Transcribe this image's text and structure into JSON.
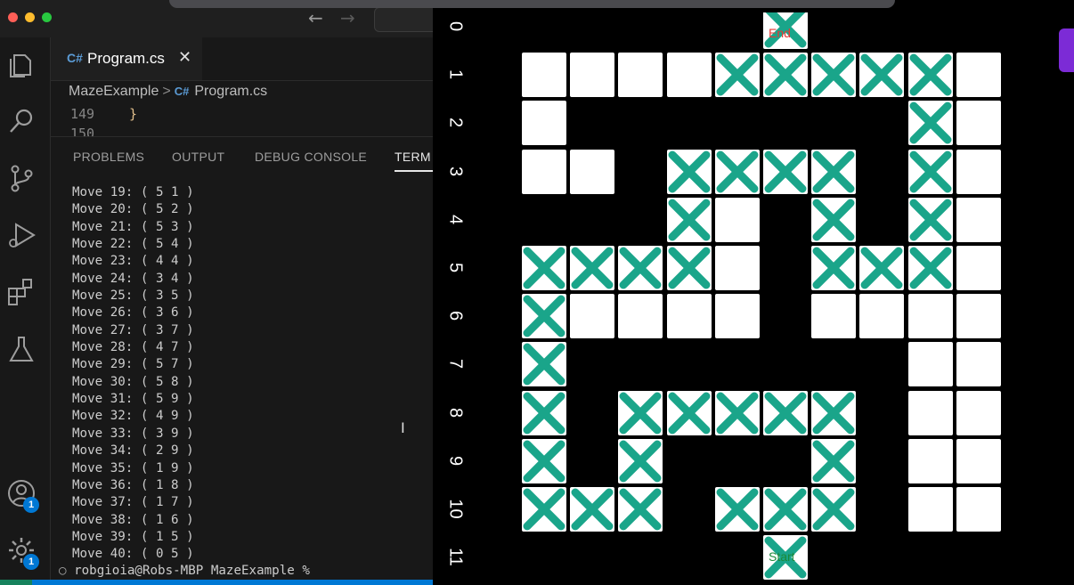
{
  "editor": {
    "tab": {
      "icon": "C#",
      "label": "Program.cs",
      "close": "✕"
    },
    "breadcrumb": {
      "folder": "MazeExample",
      "separator": ">",
      "icon": "C#",
      "file": "Program.cs"
    },
    "code_lines": [
      {
        "number": "149",
        "text": "}"
      },
      {
        "number": "150",
        "text": ""
      }
    ],
    "nav_back": "←",
    "nav_forward": "→"
  },
  "activity_bar": {
    "icons": [
      "files-icon",
      "search-icon",
      "source-control-icon",
      "run-debug-icon",
      "extensions-icon",
      "testing-icon",
      "account-icon",
      "settings-gear-icon"
    ],
    "account_badge": "1",
    "settings_badge": "1"
  },
  "panel": {
    "tabs": [
      "PROBLEMS",
      "OUTPUT",
      "DEBUG CONSOLE",
      "TERM"
    ],
    "active_tab": "TERM"
  },
  "terminal": {
    "lines": [
      "Move 19: ( 5 1 )",
      "Move 20: ( 5 2 )",
      "Move 21: ( 5 3 )",
      "Move 22: ( 5 4 )",
      "Move 23: ( 4 4 )",
      "Move 24: ( 3 4 )",
      "Move 25: ( 3 5 )",
      "Move 26: ( 3 6 )",
      "Move 27: ( 3 7 )",
      "Move 28: ( 4 7 )",
      "Move 29: ( 5 7 )",
      "Move 30: ( 5 8 )",
      "Move 31: ( 5 9 )",
      "Move 32: ( 4 9 )",
      "Move 33: ( 3 9 )",
      "Move 34: ( 2 9 )",
      "Move 35: ( 1 9 )",
      "Move 36: ( 1 8 )",
      "Move 37: ( 1 7 )",
      "Move 38: ( 1 6 )",
      "Move 39: ( 1 5 )",
      "Move 40: ( 0 5 )"
    ],
    "prompt_marker": "○",
    "prompt": "robgioia@Robs-MBP MazeExample %"
  },
  "maze": {
    "row_labels": [
      "0",
      "1",
      "2",
      "3",
      "4",
      "5",
      "6",
      "7",
      "8",
      "9",
      "10",
      "11"
    ],
    "mark_color": "#1aa58a",
    "end_label": "End",
    "end_color": "#e53935",
    "start_label": "Start",
    "start_color": "#1b8a3a",
    "grid_legend": "row r, col c; '.' empty, 'W' white cell, 'X' visited cell",
    "rows": [
      ".....X.....",
      "WWWWXXXXXW.",
      "W.......XW.",
      "WW.XXXX.XW.",
      "...XW.X.XW.",
      "XXXXW.XXXW.",
      "XWWWW.WWWW.",
      "X.......WW.",
      "X.XXXXX.WW.",
      "X.X...X.WW.",
      "XXX.XXX.WW.",
      ".....X....."
    ]
  }
}
